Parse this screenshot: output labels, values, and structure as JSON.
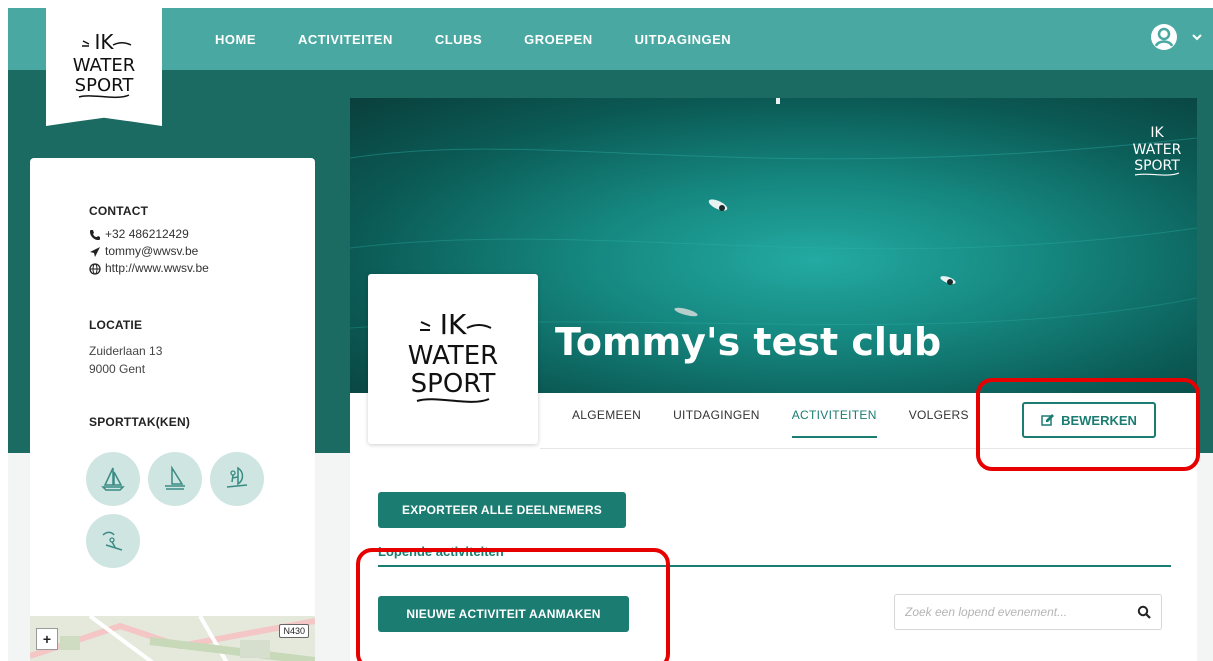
{
  "brand": {
    "logo_lines": [
      "IK",
      "WATER",
      "SPORT"
    ]
  },
  "nav": {
    "items": [
      "HOME",
      "ACTIVITEITEN",
      "CLUBS",
      "GROEPEN",
      "UITDAGINGEN"
    ]
  },
  "sidebar": {
    "contact_heading": "CONTACT",
    "phone": "+32 486212429",
    "email": "tommy@wwsv.be",
    "website": "http://www.wwsv.be",
    "location_heading": "LOCATIE",
    "address_line1": "Zuiderlaan 13",
    "address_line2": "9000 Gent",
    "sports_heading": "SPORTTAK(KEN)",
    "sports_icons": [
      "sailboat-icon",
      "catamaran-icon",
      "windsurf-icon",
      "kitesurf-icon"
    ],
    "map": {
      "zoom_in": "+",
      "road_label": "N430"
    }
  },
  "club": {
    "name": "Tommy's test club",
    "tabs": [
      "ALGEMEEN",
      "UITDAGINGEN",
      "ACTIVITEITEN",
      "VOLGERS"
    ],
    "active_tab": "ACTIVITEITEN",
    "edit_label": "BEWERKEN"
  },
  "activities": {
    "export_label": "EXPORTEER ALLE DEELNEMERS",
    "section_title": "Lopende activiteiten",
    "new_label": "NIEUWE ACTIVITEIT AANMAKEN",
    "search_placeholder": "Zoek een lopend evenement..."
  },
  "colors": {
    "primary": "#1b7c72",
    "nav": "#4aa8a2",
    "band": "#1b6b63",
    "highlight": "#e60000"
  }
}
